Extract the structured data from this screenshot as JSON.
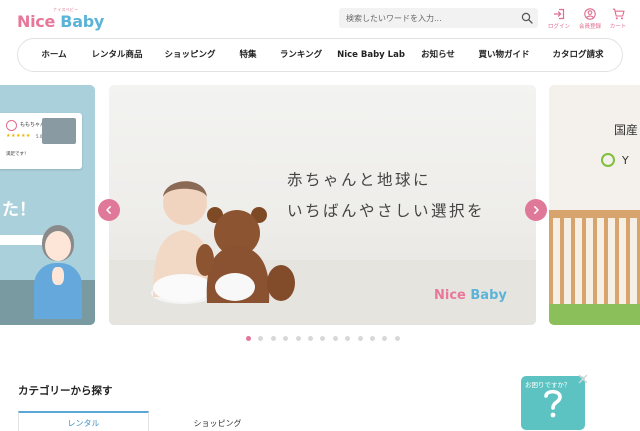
{
  "brand": {
    "logo_sub": "ナイスベビー",
    "logo_nice": "Nice ",
    "logo_baby": "Baby"
  },
  "search": {
    "placeholder": "検索したいワードを入力..."
  },
  "header_icons": [
    {
      "label": "ログイン",
      "icon": "login-icon"
    },
    {
      "label": "会員登録",
      "icon": "user-icon"
    },
    {
      "label": "カート",
      "icon": "cart-icon"
    }
  ],
  "nav": {
    "items": [
      "ホーム",
      "レンタル商品",
      "ショッピング",
      "特集",
      "ランキング",
      "Nice Baby Lab",
      "お知らせ",
      "買い物ガイド",
      "カタログ請求"
    ]
  },
  "carousel": {
    "left_slide": {
      "reviewer": "ももちゃん",
      "rating_text": "5.0",
      "review_snippet": "満足です！",
      "caption_fragment": "た！"
    },
    "main_slide": {
      "line1": "赤ちゃんと地球に",
      "line2": "いちばんやさしい選択を",
      "logo_nice": "Nice ",
      "logo_baby": "Baby"
    },
    "right_slide": {
      "heading_fragment": "国産",
      "brand_fragment": "Y"
    },
    "prev_icon": "chevron-left-icon",
    "next_icon": "chevron-right-icon",
    "dot_count": 13,
    "active_index": 0
  },
  "category": {
    "title": "カテゴリーから探す",
    "tabs": [
      "レンタル",
      "ショッピング"
    ],
    "active_tab": 0
  },
  "help": {
    "label": "お困りですか？",
    "icon": "question-icon"
  },
  "colors": {
    "brand_pink": "#e0789a",
    "brand_blue": "#5bb4d8",
    "help_teal": "#5dc3c2"
  }
}
